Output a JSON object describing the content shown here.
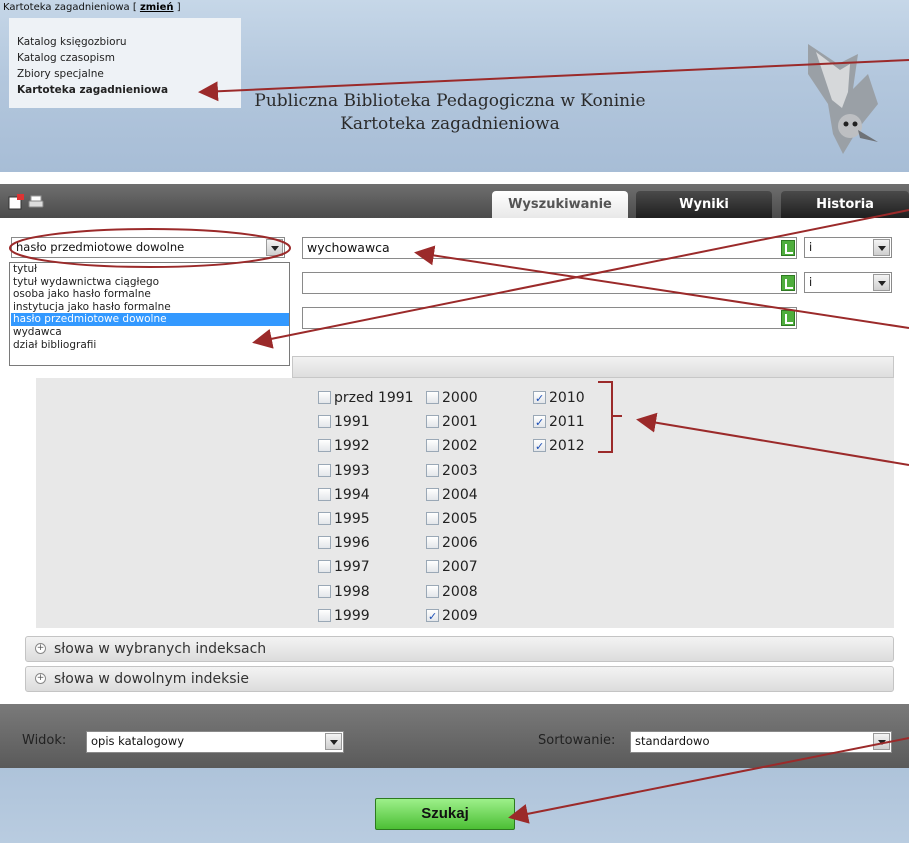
{
  "header": {
    "catalog_switch_label": "Kartoteka zagadnieniowa [",
    "catalog_switch_link": "zmień",
    "catalog_switch_end": "]",
    "catalog_menu": [
      "Katalog księgozbioru",
      "Katalog czasopism",
      "Zbiory specjalne",
      "Kartoteka zagadnieniowa"
    ],
    "title_line1": "Publiczna Biblioteka Pedagogiczna w Koninie",
    "title_line2": "Kartoteka zagadnieniowa"
  },
  "toolbar": {
    "icons": [
      "new-page-icon",
      "printer-icon"
    ],
    "tabs": [
      "Wyszukiwanie",
      "Wyniki",
      "Historia"
    ],
    "active_tab": "Wyszukiwanie"
  },
  "search": {
    "field_select_value": "hasło przedmiotowe dowolne",
    "field_options": [
      "tytuł",
      "tytuł wydawnictwa ciągłego",
      "osoba jako hasło formalne",
      "instytucja jako hasło formalne",
      "hasło przedmiotowe dowolne",
      "wydawca",
      "dział bibliografii"
    ],
    "selected_option": "hasło przedmiotowe dowolne",
    "term_1": "wychowawca",
    "term_2": "",
    "term_3": "",
    "operator_1": "i",
    "operator_2": "i"
  },
  "years": {
    "col1": [
      "przed 1991",
      "1991",
      "1992",
      "1993",
      "1994",
      "1995",
      "1996",
      "1997",
      "1998",
      "1999"
    ],
    "col2": [
      "2000",
      "2001",
      "2002",
      "2003",
      "2004",
      "2005",
      "2006",
      "2007",
      "2008",
      "2009"
    ],
    "col3": [
      "2010",
      "2011",
      "2012"
    ],
    "checked": [
      "2009",
      "2010",
      "2011",
      "2012"
    ]
  },
  "sections": {
    "indexes_selected": "słowa w wybranych indeksach",
    "indexes_any": "słowa w dowolnym indeksie"
  },
  "options": {
    "view_label": "Widok:",
    "view_value": "opis katalogowy",
    "sort_label": "Sortowanie:",
    "sort_value": "standardowo"
  },
  "actions": {
    "search_label": "Szukaj"
  },
  "colors": {
    "annotation_arrow": "#9b2a2a",
    "tab_bar": "#4b4b4b",
    "header_bg": "#b3c7dd",
    "search_button": "#4cbf35",
    "dropdown_highlight": "#3399ff"
  }
}
